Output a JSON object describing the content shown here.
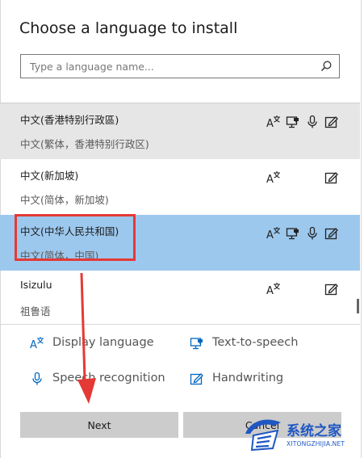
{
  "dialog": {
    "title": "Choose a language to install",
    "search": {
      "placeholder": "Type a language name..."
    }
  },
  "languages": [
    {
      "name": "中文(香港特别行政區)",
      "sub": "中文(繁体，香港特别行政区)",
      "features": [
        "display-language",
        "text-to-speech",
        "speech-recognition",
        "handwriting"
      ],
      "state": "hover"
    },
    {
      "name": "中文(新加坡)",
      "sub": "中文(简体，新加坡)",
      "features": [
        "display-language",
        "handwriting"
      ],
      "state": "normal"
    },
    {
      "name": "中文(中华人民共和国)",
      "sub": "中文(简体，中国)",
      "features": [
        "display-language",
        "text-to-speech",
        "speech-recognition",
        "handwriting"
      ],
      "state": "selected"
    },
    {
      "name": "Isizulu",
      "sub": "祖鲁语",
      "features": [
        "display-language",
        "handwriting"
      ],
      "state": "normal"
    }
  ],
  "legend": {
    "display_language": "Display language",
    "text_to_speech": "Text-to-speech",
    "speech_recognition": "Speech recognition",
    "handwriting": "Handwriting"
  },
  "buttons": {
    "next": "Next",
    "cancel": "Cancel"
  },
  "watermark": {
    "cn": "系统之家",
    "en": "XITONGZHIJIA.NET"
  },
  "colors": {
    "selected_row": "#9dc8ee",
    "hover_row": "#e6e6e6",
    "annotation": "#e53935",
    "button": "#cccccc",
    "watermark": "#1f57c3"
  }
}
